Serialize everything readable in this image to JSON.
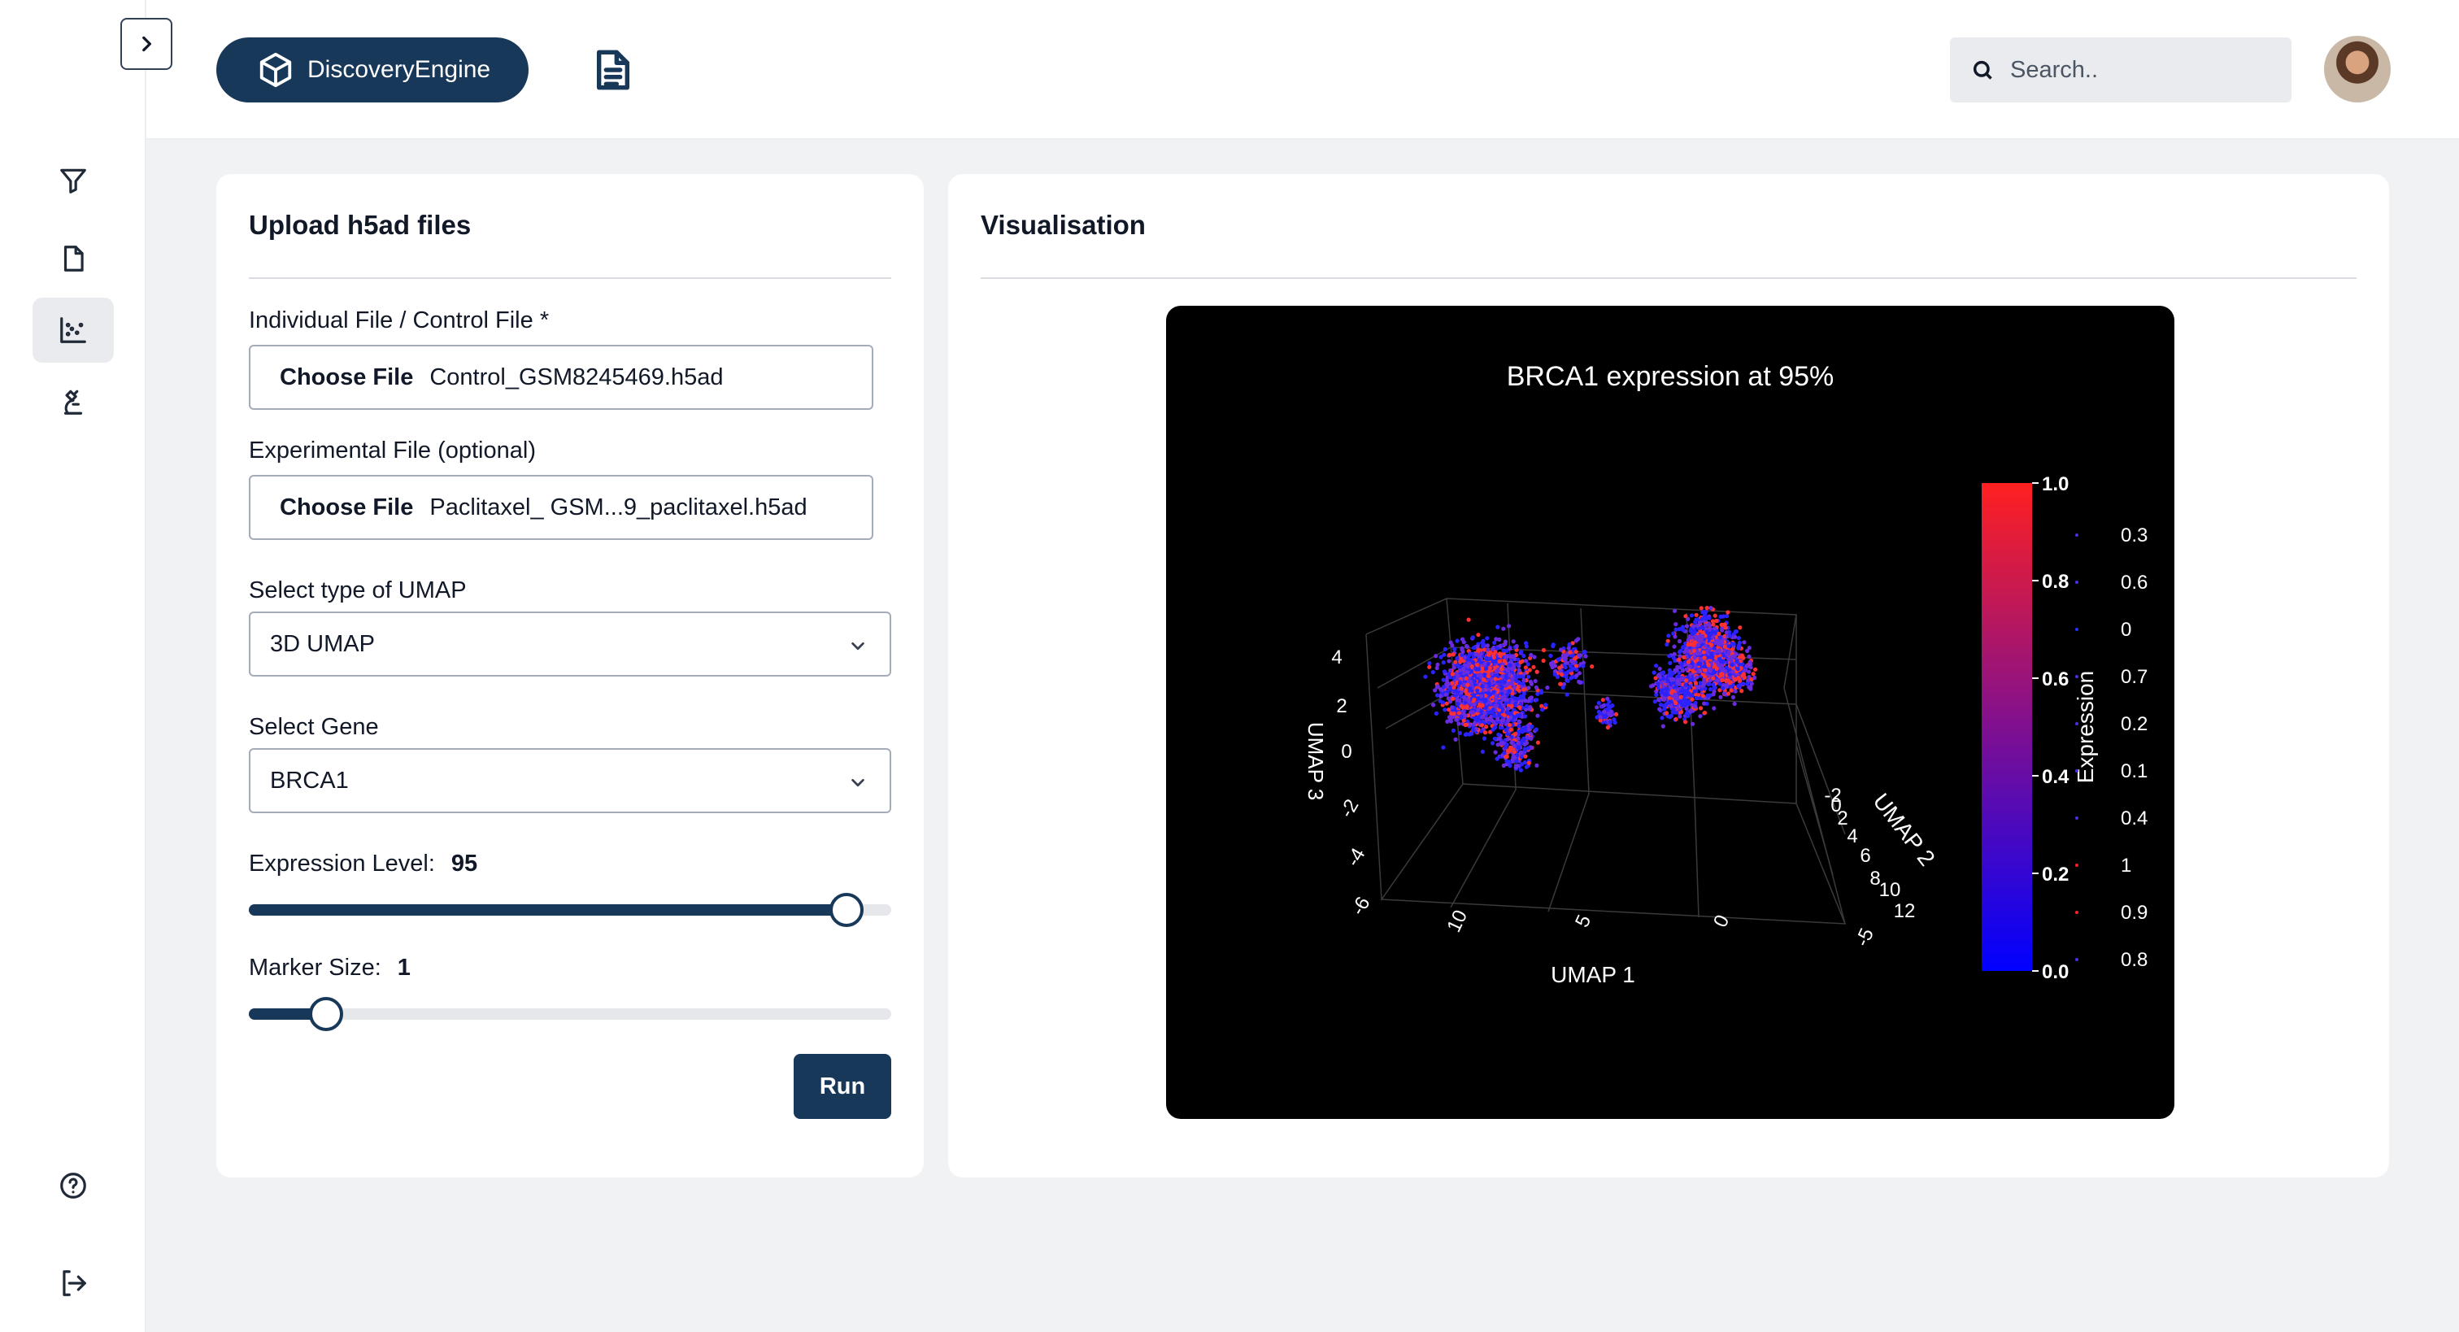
{
  "app": {
    "brand_name": "DiscoveryEngine"
  },
  "search": {
    "placeholder": "Search.."
  },
  "sidebar": {
    "items": [
      {
        "icon": "filter-icon"
      },
      {
        "icon": "file-icon"
      },
      {
        "icon": "scatter-chart-icon",
        "active": true
      },
      {
        "icon": "microscope-icon"
      }
    ],
    "bottom": [
      {
        "icon": "help-circle-icon"
      },
      {
        "icon": "logout-icon"
      }
    ]
  },
  "upload": {
    "title": "Upload h5ad files",
    "individual_label": "Individual File / Control File *",
    "individual_button": "Choose File",
    "individual_file": "Control_GSM8245469.h5ad",
    "experimental_label": "Experimental File (optional)",
    "experimental_button": "Choose File",
    "experimental_file": "Paclitaxel_ GSM...9_paclitaxel.h5ad",
    "umap_label": "Select type of UMAP",
    "umap_value": "3D UMAP",
    "gene_label": "Select Gene",
    "gene_value": "BRCA1",
    "expression_label": "Expression Level:",
    "expression_value": "95",
    "expression_fraction": 0.93,
    "marker_label": "Marker Size:",
    "marker_value": "1",
    "marker_fraction": 0.12,
    "run_label": "Run"
  },
  "visualisation": {
    "title": "Visualisation"
  },
  "chart_data": {
    "type": "scatter",
    "title": "BRCA1 expression at 95%",
    "xlabel": "UMAP 1",
    "ylabel": "UMAP 2",
    "zlabel": "UMAP 3",
    "x_ticks": [
      "10",
      "5",
      "0",
      "-5"
    ],
    "y_ticks": [
      "-2",
      "0",
      "2",
      "4",
      "6",
      "8",
      "10",
      "12"
    ],
    "z_ticks": [
      "4",
      "2",
      "0",
      "-2",
      "-4",
      "-6"
    ],
    "colorbar": {
      "title": "Expression",
      "ticks": [
        "1.0",
        "0.8",
        "0.6",
        "0.4",
        "0.2",
        "0.0"
      ],
      "range": [
        0,
        1
      ],
      "colors": [
        "#0000ff",
        "#ff2020"
      ]
    },
    "legend_values": [
      "0.3",
      "0.6",
      "0",
      "0.7",
      "0.2",
      "0.1",
      "0.4",
      "1",
      "0.9",
      "0.8"
    ],
    "background": "#000000"
  },
  "colors": {
    "accent": "#183859",
    "page_bg": "#f1f2f4"
  }
}
